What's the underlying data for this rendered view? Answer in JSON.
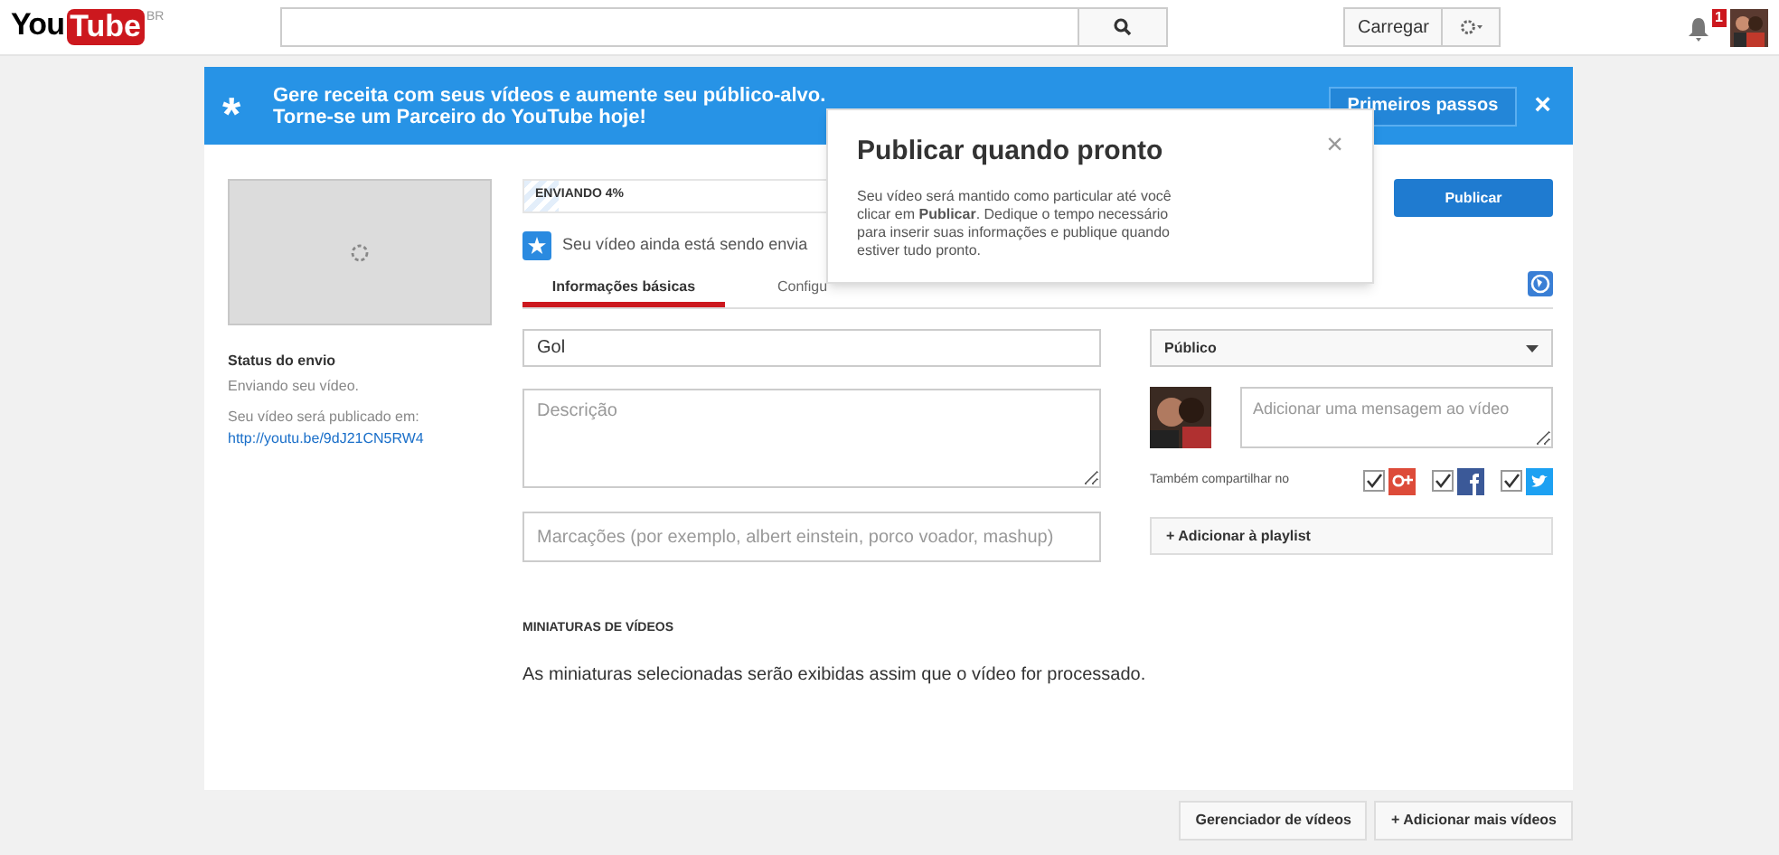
{
  "header": {
    "logo": "You",
    "logo_box": "Tube",
    "region": "BR",
    "upload_button": "Carregar",
    "notifications": "1"
  },
  "banner": {
    "icon": "*",
    "lines": [
      "Gere receita com seus vídeos e aumente seu público-alvo.",
      "Torne-se um Parceiro do YouTube hoje!"
    ],
    "button": "Primeiros passos",
    "close": "×"
  },
  "upload": {
    "status_title": "Status do envio",
    "status_text": "Enviando seu vídeo.",
    "publish_note": "Seu vídeo será publicado em:",
    "link": "http://youtu.be/9dJ21CN5RW4",
    "progress": {
      "label": "ENVIANDO 4%",
      "level": 0.04
    },
    "notice": "Seu vídeo ainda está sendo envia"
  },
  "tabs": [
    {
      "label": "Informações básicas",
      "selected": true
    },
    {
      "label": "Configu",
      "selected": false
    }
  ],
  "form": {
    "title": "Gol",
    "description": {
      "placeholder": "Descrição"
    },
    "tags": {
      "placeholder": "Marcações (por exemplo, albert einstein, porco voador, mashup)"
    }
  },
  "privacy": "Público",
  "message": {
    "placeholder": "Adicionar uma mensagem ao vídeo"
  },
  "share": {
    "label": "Também compartilhar no",
    "networks": [
      {
        "kind": "gplus",
        "checked": true,
        "color": "#dd4b39"
      },
      {
        "kind": "facebook",
        "checked": true,
        "color": "#3b5998"
      },
      {
        "kind": "twitter",
        "checked": true,
        "color": "#1da1f2"
      }
    ]
  },
  "playlist_button": "+ Adicionar à playlist",
  "thumbnails": {
    "heading": "MINIATURAS DE VÍDEOS",
    "text": "As miniaturas selecionadas serão exibidas assim que o vídeo for processado."
  },
  "publish_button": "Publicar",
  "popup": {
    "title": "Publicar quando pronto",
    "body": "Seu vídeo será mantido como particular até você clicar em **Publicar**. Dedique o tempo necessário para inserir suas informações e publique quando estiver tudo pronto.",
    "close": "×"
  },
  "footer_buttons": [
    "Gerenciador de vídeos",
    "+ Adicionar mais vídeos"
  ]
}
